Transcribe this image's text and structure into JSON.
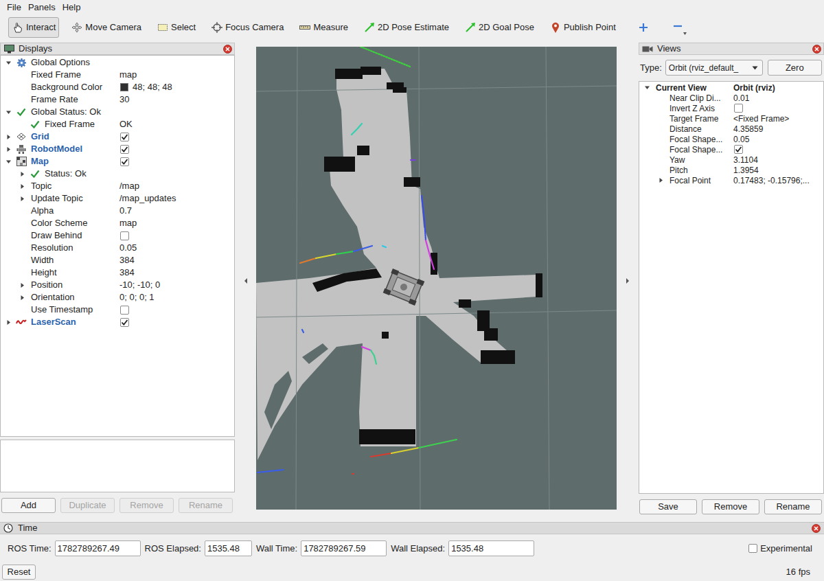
{
  "menu": [
    "File",
    "Panels",
    "Help"
  ],
  "toolbar": [
    {
      "label": "Interact",
      "selected": true,
      "kind": "interact"
    },
    {
      "label": "Move Camera",
      "selected": false,
      "kind": "move"
    },
    {
      "label": "Select",
      "selected": false,
      "kind": "select"
    },
    {
      "label": "Focus Camera",
      "selected": false,
      "kind": "focus"
    },
    {
      "label": "Measure",
      "selected": false,
      "kind": "measure"
    },
    {
      "label": "2D Pose Estimate",
      "selected": false,
      "kind": "arrow"
    },
    {
      "label": "2D Goal Pose",
      "selected": false,
      "kind": "arrow"
    },
    {
      "label": "Publish Point",
      "selected": false,
      "kind": "pin"
    }
  ],
  "displays": {
    "title": "Displays",
    "rows": [
      {
        "label": "Global Options",
        "depth": 0,
        "expandable": true,
        "expanded": true,
        "kind": "gear",
        "value": {
          "kind": "empty"
        }
      },
      {
        "label": "Fixed Frame",
        "depth": 1,
        "expandable": false,
        "expanded": false,
        "kind": "property",
        "value": {
          "kind": "text",
          "text": "map"
        }
      },
      {
        "label": "Background Color",
        "depth": 1,
        "expandable": false,
        "expanded": false,
        "kind": "property",
        "value": {
          "kind": "color",
          "color": "#303030",
          "text": "48; 48; 48"
        }
      },
      {
        "label": "Frame Rate",
        "depth": 1,
        "expandable": false,
        "expanded": false,
        "kind": "property",
        "value": {
          "kind": "text",
          "text": "30"
        }
      },
      {
        "label": "Global Status: Ok",
        "depth": 0,
        "expandable": true,
        "expanded": true,
        "kind": "status",
        "value": {
          "kind": "empty"
        }
      },
      {
        "label": "Fixed Frame",
        "depth": 1,
        "expandable": false,
        "expanded": false,
        "kind": "status",
        "value": {
          "kind": "text",
          "text": "OK"
        }
      },
      {
        "label": "Grid",
        "depth": 0,
        "expandable": true,
        "expanded": false,
        "kind": "grid",
        "value": {
          "kind": "checkbox",
          "checked": true
        }
      },
      {
        "label": "RobotModel",
        "depth": 0,
        "expandable": true,
        "expanded": false,
        "kind": "robot",
        "value": {
          "kind": "checkbox",
          "checked": true
        }
      },
      {
        "label": "Map",
        "depth": 0,
        "expandable": true,
        "expanded": true,
        "kind": "map",
        "value": {
          "kind": "checkbox",
          "checked": true
        }
      },
      {
        "label": "Status: Ok",
        "depth": 1,
        "expandable": true,
        "expanded": false,
        "kind": "status",
        "value": {
          "kind": "empty"
        }
      },
      {
        "label": "Topic",
        "depth": 1,
        "expandable": true,
        "expanded": false,
        "kind": "property",
        "value": {
          "kind": "text",
          "text": "/map"
        }
      },
      {
        "label": "Update Topic",
        "depth": 1,
        "expandable": true,
        "expanded": false,
        "kind": "property",
        "value": {
          "kind": "text",
          "text": "/map_updates"
        }
      },
      {
        "label": "Alpha",
        "depth": 1,
        "expandable": false,
        "expanded": false,
        "kind": "property",
        "value": {
          "kind": "text",
          "text": "0.7"
        }
      },
      {
        "label": "Color Scheme",
        "depth": 1,
        "expandable": false,
        "expanded": false,
        "kind": "property",
        "value": {
          "kind": "text",
          "text": "map"
        }
      },
      {
        "label": "Draw Behind",
        "depth": 1,
        "expandable": false,
        "expanded": false,
        "kind": "property",
        "value": {
          "kind": "checkbox",
          "checked": false
        }
      },
      {
        "label": "Resolution",
        "depth": 1,
        "expandable": false,
        "expanded": false,
        "kind": "property",
        "value": {
          "kind": "text",
          "text": "0.05"
        }
      },
      {
        "label": "Width",
        "depth": 1,
        "expandable": false,
        "expanded": false,
        "kind": "property",
        "value": {
          "kind": "text",
          "text": "384"
        }
      },
      {
        "label": "Height",
        "depth": 1,
        "expandable": false,
        "expanded": false,
        "kind": "property",
        "value": {
          "kind": "text",
          "text": "384"
        }
      },
      {
        "label": "Position",
        "depth": 1,
        "expandable": true,
        "expanded": false,
        "kind": "property",
        "value": {
          "kind": "text",
          "text": "-10; -10; 0"
        }
      },
      {
        "label": "Orientation",
        "depth": 1,
        "expandable": true,
        "expanded": false,
        "kind": "property",
        "value": {
          "kind": "text",
          "text": "0; 0; 0; 1"
        }
      },
      {
        "label": "Use Timestamp",
        "depth": 1,
        "expandable": false,
        "expanded": false,
        "kind": "property",
        "value": {
          "kind": "checkbox",
          "checked": false
        }
      },
      {
        "label": "LaserScan",
        "depth": 0,
        "expandable": true,
        "expanded": false,
        "kind": "laser",
        "value": {
          "kind": "checkbox",
          "checked": true
        }
      }
    ],
    "buttons": [
      {
        "label": "Add",
        "disabled": false
      },
      {
        "label": "Duplicate",
        "disabled": true
      },
      {
        "label": "Remove",
        "disabled": true
      },
      {
        "label": "Rename",
        "disabled": true
      }
    ]
  },
  "views": {
    "title": "Views",
    "type_label": "Type:",
    "type_value": "Orbit (rviz_default_",
    "zero": "Zero",
    "rows": [
      {
        "label": "Current View",
        "depth": 0,
        "expandable": true,
        "expanded": true,
        "kind": "heading",
        "value": {
          "kind": "text",
          "text": "Orbit (rviz)"
        }
      },
      {
        "label": "Near Clip Di...",
        "depth": 1,
        "expandable": false,
        "expanded": false,
        "kind": "property",
        "value": {
          "kind": "text",
          "text": "0.01"
        }
      },
      {
        "label": "Invert Z Axis",
        "depth": 1,
        "expandable": false,
        "expanded": false,
        "kind": "property",
        "value": {
          "kind": "checkbox",
          "checked": false
        }
      },
      {
        "label": "Target Frame",
        "depth": 1,
        "expandable": false,
        "expanded": false,
        "kind": "property",
        "value": {
          "kind": "text",
          "text": "<Fixed Frame>"
        }
      },
      {
        "label": "Distance",
        "depth": 1,
        "expandable": false,
        "expanded": false,
        "kind": "property",
        "value": {
          "kind": "text",
          "text": "4.35859"
        }
      },
      {
        "label": "Focal Shape...",
        "depth": 1,
        "expandable": false,
        "expanded": false,
        "kind": "property",
        "value": {
          "kind": "text",
          "text": "0.05"
        }
      },
      {
        "label": "Focal Shape...",
        "depth": 1,
        "expandable": false,
        "expanded": false,
        "kind": "property",
        "value": {
          "kind": "checkbox",
          "checked": true
        }
      },
      {
        "label": "Yaw",
        "depth": 1,
        "expandable": false,
        "expanded": false,
        "kind": "property",
        "value": {
          "kind": "text",
          "text": "3.1104"
        }
      },
      {
        "label": "Pitch",
        "depth": 1,
        "expandable": false,
        "expanded": false,
        "kind": "property",
        "value": {
          "kind": "text",
          "text": "1.3954"
        }
      },
      {
        "label": "Focal Point",
        "depth": 1,
        "expandable": true,
        "expanded": false,
        "kind": "property",
        "value": {
          "kind": "text",
          "text": "0.17483; -0.15796;..."
        }
      }
    ],
    "buttons": [
      "Save",
      "Remove",
      "Rename"
    ]
  },
  "time": {
    "title": "Time",
    "fields": [
      {
        "label": "ROS Time:",
        "value": "1782789267.49"
      },
      {
        "label": "ROS Elapsed:",
        "value": "1535.48"
      },
      {
        "label": "Wall Time:",
        "value": "1782789267.59"
      },
      {
        "label": "Wall Elapsed:",
        "value": "1535.48"
      }
    ],
    "experimental": {
      "label": "Experimental",
      "checked": false
    },
    "reset": "Reset",
    "fps": "16 fps"
  }
}
